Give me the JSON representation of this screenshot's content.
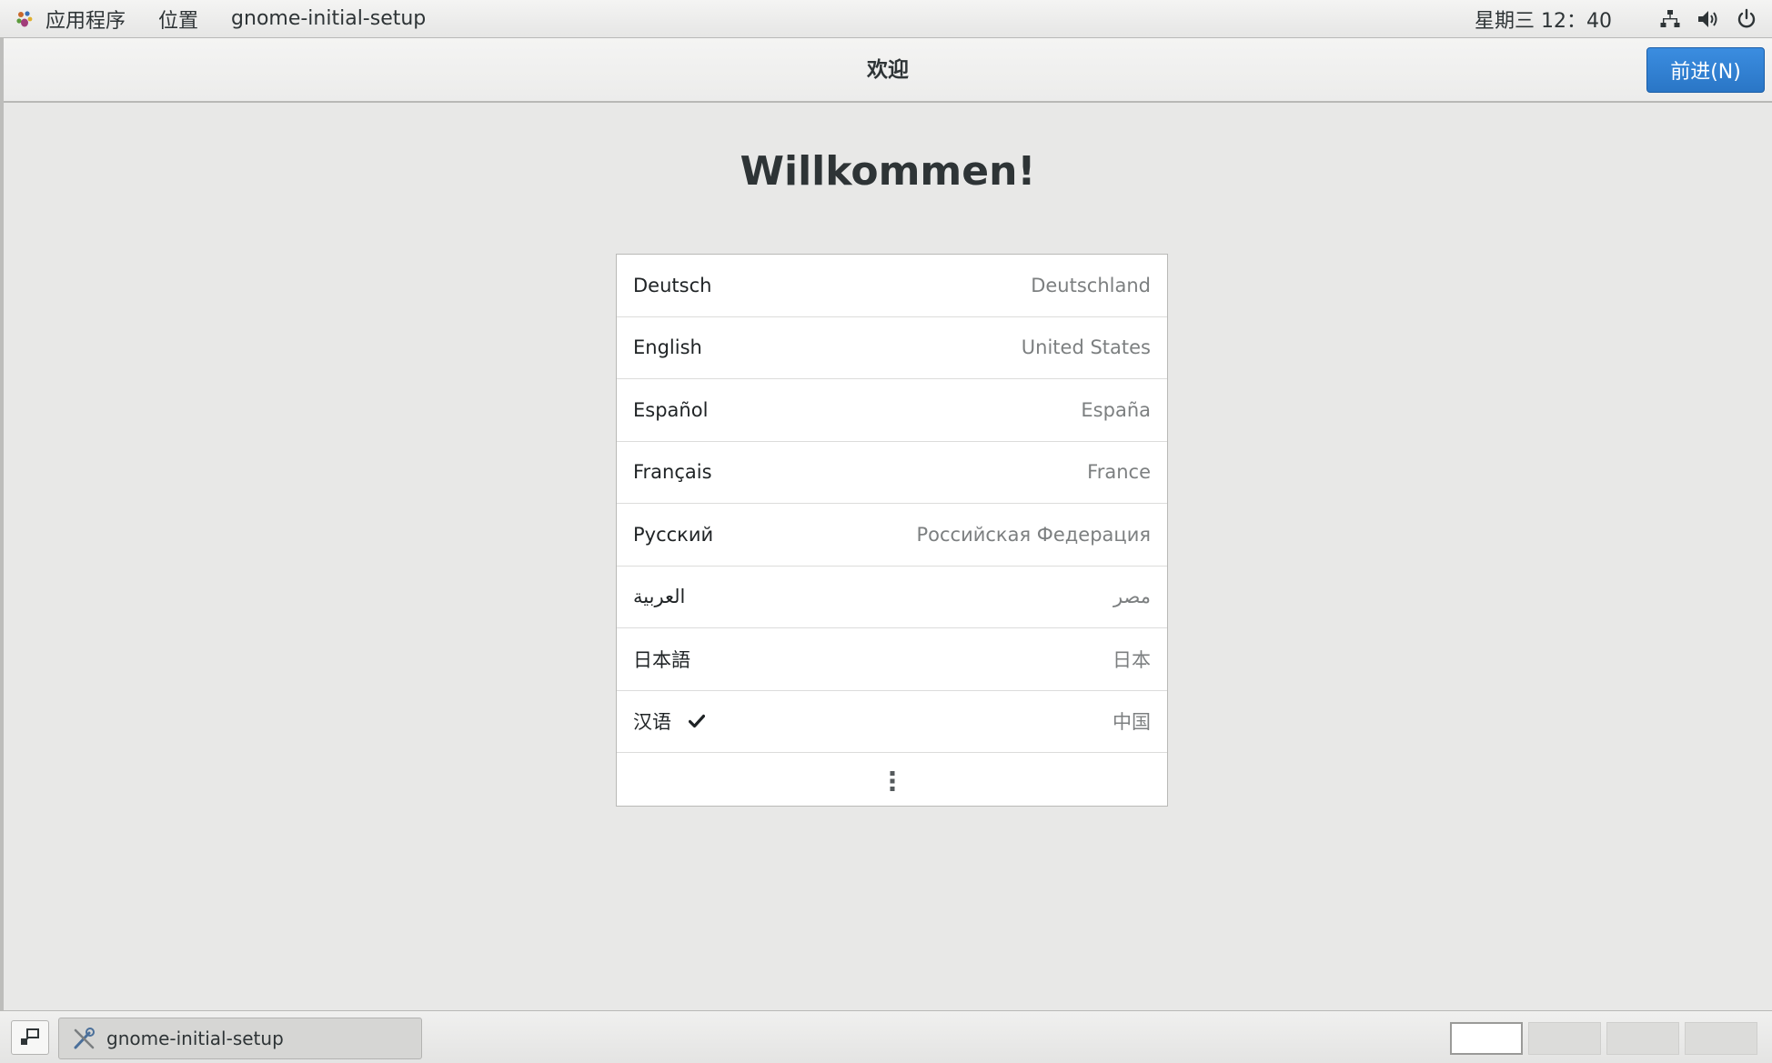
{
  "topbar": {
    "apps_label": "应用程序",
    "places_label": "位置",
    "app_name": "gnome-initial-setup",
    "clock": "星期三 12：40"
  },
  "window": {
    "title": "欢迎",
    "next_button": "前进(N)"
  },
  "welcome_heading": "Willkommen!",
  "languages": [
    {
      "language": "Deutsch",
      "region": "Deutschland",
      "selected": false
    },
    {
      "language": "English",
      "region": "United States",
      "selected": false
    },
    {
      "language": "Español",
      "region": "España",
      "selected": false
    },
    {
      "language": "Français",
      "region": "France",
      "selected": false
    },
    {
      "language": "Русский",
      "region": "Российская Федерация",
      "selected": false
    },
    {
      "language": "العربية",
      "region": "مصر",
      "selected": false
    },
    {
      "language": "日本語",
      "region": "日本",
      "selected": false
    },
    {
      "language": "汉语",
      "region": "中国",
      "selected": true
    }
  ],
  "taskbar": {
    "task_label": "gnome-initial-setup",
    "workspace_count": 4,
    "active_workspace": 1
  },
  "colors": {
    "accent": "#3584e4",
    "background": "#e8e8e7"
  }
}
